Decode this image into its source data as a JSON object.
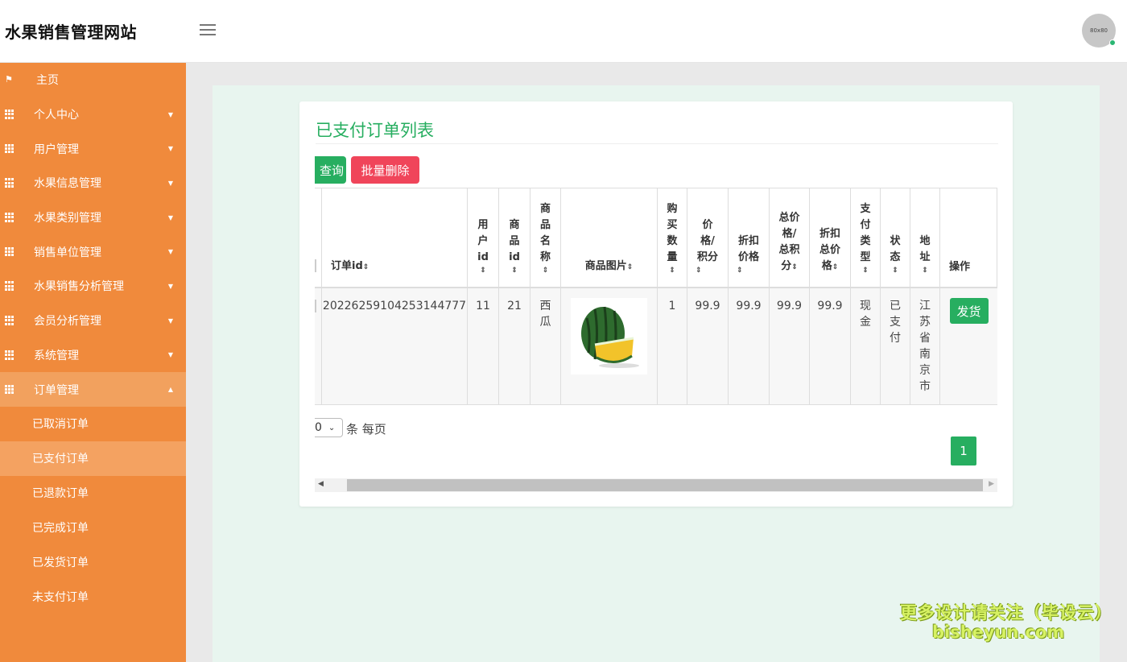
{
  "app": {
    "title": "水果销售管理网站",
    "avatar_text": "80x80"
  },
  "sidebar": {
    "items": [
      {
        "label": "主页",
        "icon": "flag-icon"
      },
      {
        "label": "个人中心",
        "icon": "grid-icon"
      },
      {
        "label": "用户管理",
        "icon": "grid-icon"
      },
      {
        "label": "水果信息管理",
        "icon": "grid-icon"
      },
      {
        "label": "水果类别管理",
        "icon": "grid-icon"
      },
      {
        "label": "销售单位管理",
        "icon": "grid-icon"
      },
      {
        "label": "水果销售分析管理",
        "icon": "grid-icon"
      },
      {
        "label": "会员分析管理",
        "icon": "grid-icon"
      },
      {
        "label": "系统管理",
        "icon": "grid-icon"
      },
      {
        "label": "订单管理",
        "icon": "grid-icon"
      }
    ],
    "sub_items": [
      "已取消订单",
      "已支付订单",
      "已退款订单",
      "已完成订单",
      "已发货订单",
      "未支付订单"
    ],
    "active_sub": "已支付订单"
  },
  "main": {
    "title": "已支付订单列表",
    "search_label": "查询",
    "batch_delete_label": "批量删除",
    "columns": [
      "订单id",
      "用户id",
      "商品id",
      "商品名称",
      "商品图片",
      "购买数量",
      "价格/积分",
      "折扣价格",
      "总价格/总积分",
      "折扣总价格",
      "支付类型",
      "状态",
      "地址",
      "操作"
    ],
    "row": {
      "order_id": "20226259104253144777",
      "user_id": "11",
      "product_id": "21",
      "product_name": "西瓜",
      "quantity": "1",
      "price": "99.9",
      "discount_price": "99.9",
      "total_price": "99.9",
      "discount_total": "99.9",
      "pay_type": "现金",
      "status": "已支付",
      "address": "江苏省南京市",
      "action_label": "发货"
    },
    "page_size": "0",
    "per_page_label": "条 每页",
    "current_page": "1"
  },
  "watermark": {
    "line1": "更多设计请关注（毕设云）",
    "line2": "bisheyun.com"
  },
  "colors": {
    "sidebar": "#f08a3c",
    "accent": "#27ae60",
    "danger": "#f0455a"
  }
}
